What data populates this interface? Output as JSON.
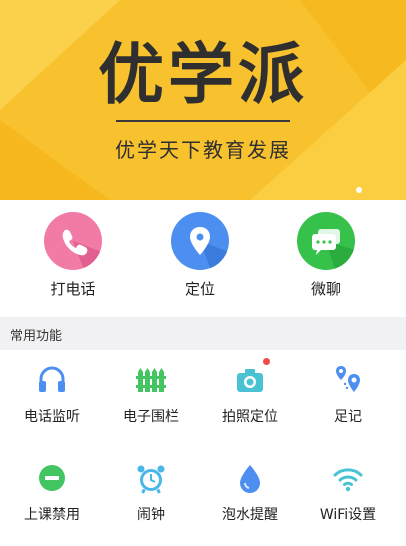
{
  "banner": {
    "title": "优学派",
    "subtitle": "优学天下教育发展"
  },
  "quick_actions": [
    {
      "label": "打电话",
      "icon": "phone-icon",
      "color": "#f27aa6"
    },
    {
      "label": "定位",
      "icon": "location-pin-icon",
      "color": "#4d8ff0"
    },
    {
      "label": "微聊",
      "icon": "chat-bubble-icon",
      "color": "#36c24a"
    }
  ],
  "section": {
    "title": "常用功能"
  },
  "functions": [
    {
      "label": "电话监听",
      "icon": "headphones-icon",
      "color": "#4d8ff0"
    },
    {
      "label": "电子围栏",
      "icon": "fence-icon",
      "color": "#43c561"
    },
    {
      "label": "拍照定位",
      "icon": "camera-icon",
      "color": "#49c3d4"
    },
    {
      "label": "足记",
      "icon": "footprint-pins-icon",
      "color": "#4d8ff0"
    },
    {
      "label": "上课禁用",
      "icon": "no-entry-icon",
      "color": "#43c561"
    },
    {
      "label": "闹钟",
      "icon": "alarm-clock-icon",
      "color": "#49b7e8"
    },
    {
      "label": "泡水提醒",
      "icon": "water-drop-icon",
      "color": "#4d8ff0"
    },
    {
      "label": "WiFi设置",
      "icon": "wifi-icon",
      "color": "#49c3d4"
    }
  ],
  "colors": {
    "banner": "#f8c22e",
    "section_bg": "#f1f1f3",
    "badge": "#f04a4a"
  }
}
